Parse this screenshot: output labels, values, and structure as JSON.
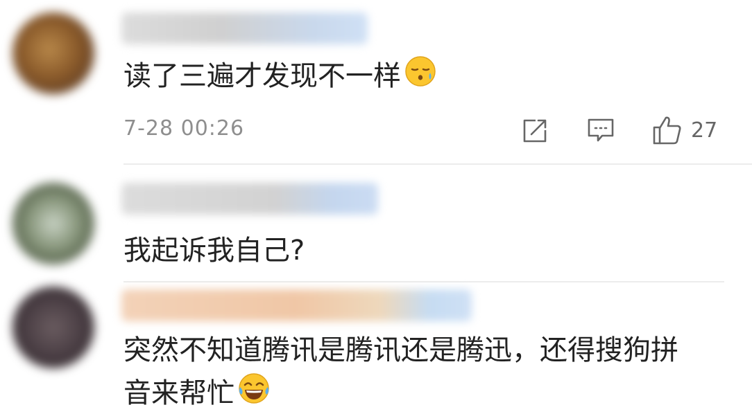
{
  "comments": [
    {
      "text": "读了三遍才发现不一样",
      "emoji": "sweat-face-emoji",
      "timestamp": "7-28 00:26",
      "likes": "27"
    },
    {
      "text": "我起诉我自己?"
    },
    {
      "text_line1": "突然不知道腾讯是腾讯还是腾迅，还得搜狗拼",
      "text_line2": "音来帮忙",
      "emoji": "tears-of-joy-emoji"
    }
  ],
  "colors": {
    "text": "#222222",
    "meta": "#8e8e8e",
    "icon": "#666666",
    "divider": "#ececec"
  },
  "icons": [
    "share-icon",
    "reply-icon",
    "thumbs-up-icon"
  ]
}
